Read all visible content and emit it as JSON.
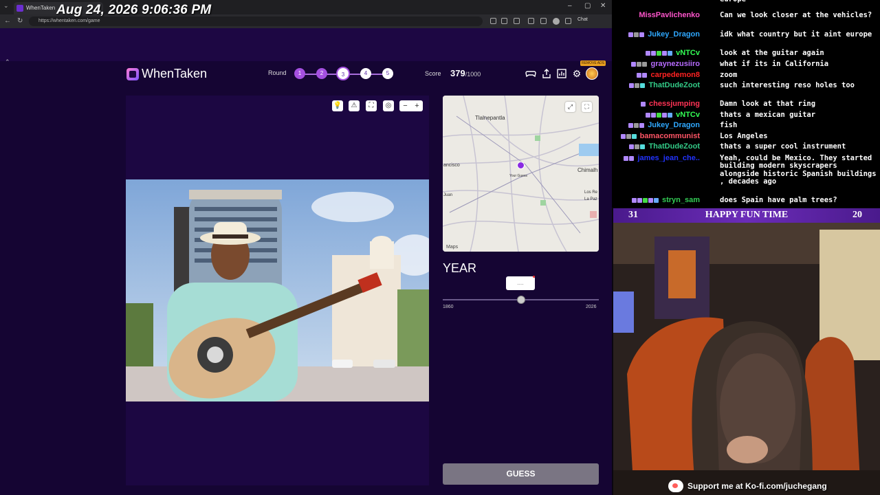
{
  "overlay": {
    "timestamp": "Aug 24, 2026 9:06:36 PM"
  },
  "browser": {
    "tab_title": "WhenTaken",
    "url": "https://whentaken.com/game",
    "chat_label": "Chat"
  },
  "app": {
    "logo_text": "WhenTaken",
    "remove_ads_label": "REMOVE ADS",
    "round_label": "Round",
    "rounds": [
      "1",
      "2",
      "3",
      "4",
      "5"
    ],
    "current_round": 3,
    "score_label": "Score",
    "score_value": "379",
    "score_max": "/1000"
  },
  "map": {
    "labels": {
      "tlalnepantla": "Tlalnepantla",
      "francisco": "ancisco",
      "chimal": "Chimalh",
      "your_guess": "Your Guess",
      "los_reyes": "Los Re",
      "paz": "La Paz",
      "juan": "Juan"
    },
    "watermark": "Maps"
  },
  "year": {
    "title": "YEAR",
    "value_placeholder": "....",
    "min": "1860",
    "max": "2026",
    "slider_fraction": 0.5
  },
  "guess_button_label": "GUESS",
  "chat": {
    "messages": [
      {
        "user": "",
        "text": "europe",
        "color": "#ff6ad5",
        "badges": []
      },
      {
        "user": "MissPavlichenko",
        "text": "Can we look closer at the vehicles?",
        "color": "#ff55cc",
        "badges": []
      },
      {
        "user": "Jukey_Dragon",
        "text": "idk what country but it aint europe",
        "color": "#2fa8ff",
        "badges": [
          "#b088ff",
          "#999999",
          "#b088ff"
        ]
      },
      {
        "user": "vNTCv",
        "text": "look at the guitar again",
        "color": "#33ff55",
        "badges": [
          "#b088ff",
          "#b088ff",
          "#44dd44",
          "#b088ff",
          "#66aaff"
        ]
      },
      {
        "user": "graynezusiiro",
        "text": "what if its in California",
        "color": "#b76bff",
        "badges": [
          "#b088ff",
          "#999999",
          "#999999"
        ]
      },
      {
        "user": "carpedemon8",
        "text": "zoom",
        "color": "#ff2222",
        "badges": [
          "#b088ff",
          "#b088ff"
        ]
      },
      {
        "user": "ThatDudeZoot",
        "text": "such interesting reso holes too",
        "color": "#33cc88",
        "badges": [
          "#b088ff",
          "#999999",
          "#55dddd"
        ]
      },
      {
        "user": "chessjumping",
        "text": "Damn look at that ring",
        "color": "#ff3355",
        "badges": [
          "#b088ff"
        ]
      },
      {
        "user": "vNTCv",
        "text": "thats a mexican guitar",
        "color": "#33ff55",
        "badges": [
          "#b088ff",
          "#b088ff",
          "#44dd44",
          "#b088ff",
          "#66aaff"
        ]
      },
      {
        "user": "Jukey_Dragon",
        "text": "fish",
        "color": "#2fa8ff",
        "badges": [
          "#b088ff",
          "#999999",
          "#b088ff"
        ]
      },
      {
        "user": "bamacommunist",
        "text": "Los Angeles",
        "color": "#ff5566",
        "badges": [
          "#b088ff",
          "#999999",
          "#55dddd"
        ]
      },
      {
        "user": "ThatDudeZoot",
        "text": "thats a super cool instrument",
        "color": "#33cc88",
        "badges": [
          "#b088ff",
          "#999999",
          "#55dddd"
        ]
      },
      {
        "user": "james_jean_che..",
        "text": "Yeah, could be Mexico. They started building modern skyscrapers alongside historic Spanish buildings , decades ago",
        "color": "#2233ff",
        "badges": [
          "#b088ff",
          "#b088ff"
        ]
      },
      {
        "user": "stryn_sam",
        "text": "does Spain have palm trees?",
        "color": "#33cc55",
        "badges": [
          "#b088ff",
          "#b088ff",
          "#44dd44",
          "#b088ff",
          "#66aaff"
        ]
      }
    ]
  },
  "banner": {
    "left": "31",
    "title": "HAPPY FUN TIME",
    "right": "20"
  },
  "kofi_text": "Support me at Ko-fi.com/juchegang"
}
